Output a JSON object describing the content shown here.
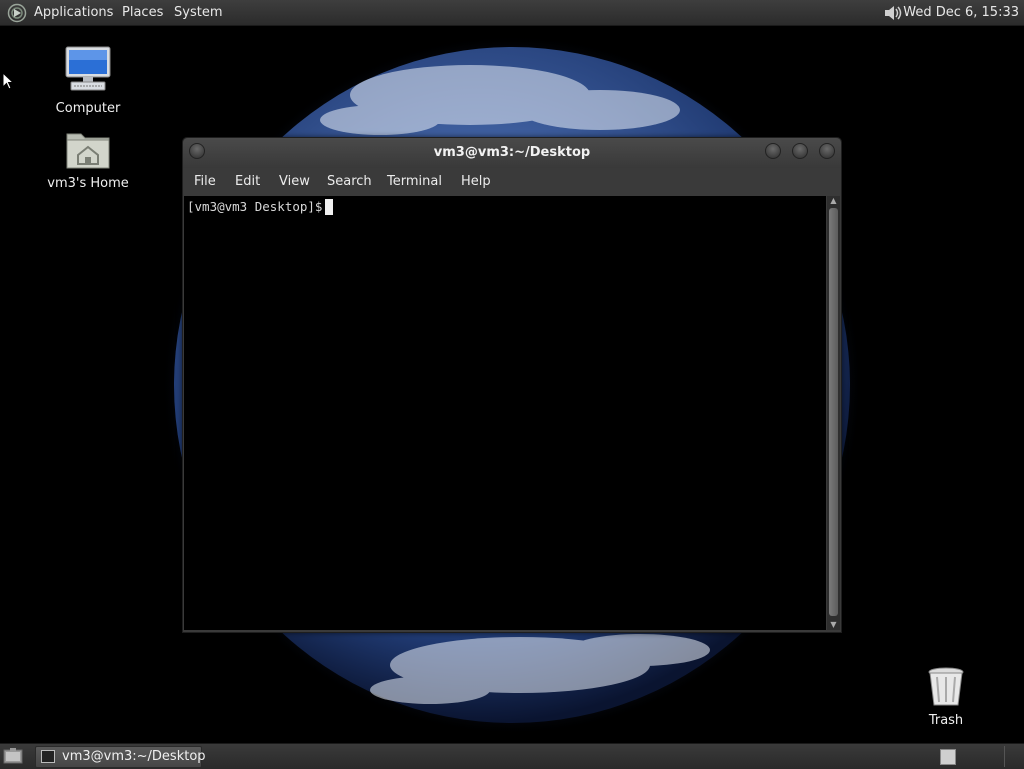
{
  "top_panel": {
    "menus": [
      "Applications",
      "Places",
      "System"
    ],
    "clock": "Wed Dec  6, 15:33"
  },
  "desktop": {
    "icons": [
      {
        "label": "Computer",
        "icon": "computer-icon"
      },
      {
        "label": "vm3's Home",
        "icon": "home-folder-icon"
      },
      {
        "label": "Trash",
        "icon": "trash-icon"
      }
    ]
  },
  "terminal": {
    "title": "vm3@vm3:~/Desktop",
    "menu": [
      "File",
      "Edit",
      "View",
      "Search",
      "Terminal",
      "Help"
    ],
    "prompt": "[vm3@vm3 Desktop]$"
  },
  "taskbar": {
    "tasks": [
      {
        "label": "vm3@vm3:~/Desktop",
        "icon": "terminal-icon"
      }
    ]
  },
  "colors": {
    "panel": "#2f2f2f",
    "terminal_bg": "#000000",
    "earth_blue": "#3a5a9a"
  }
}
